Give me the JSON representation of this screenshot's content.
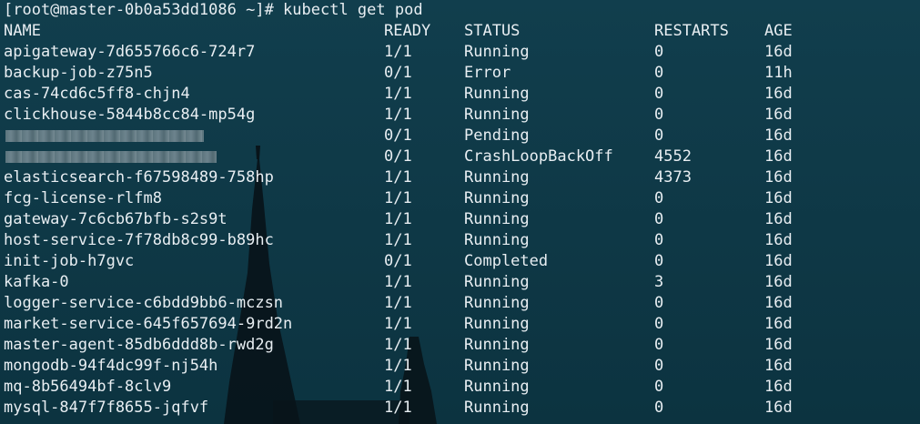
{
  "terminal": {
    "prompt": "[root@master-0b0a53dd1086 ~]# kubectl get pod",
    "headers": {
      "name": "NAME",
      "ready": "READY",
      "status": "STATUS",
      "restarts": "RESTARTS",
      "age": "AGE"
    },
    "rows": [
      {
        "name": "apigateway-7d655766c6-724r7",
        "ready": "1/1",
        "status": "Running",
        "restarts": "0",
        "age": "16d"
      },
      {
        "name": "backup-job-z75n5",
        "ready": "0/1",
        "status": "Error",
        "restarts": "0",
        "age": "11h"
      },
      {
        "name": "cas-74cd6c5ff8-chjn4",
        "ready": "1/1",
        "status": "Running",
        "restarts": "0",
        "age": "16d"
      },
      {
        "name": "clickhouse-5844b8cc84-mp54g",
        "ready": "1/1",
        "status": "Running",
        "restarts": "0",
        "age": "16d"
      },
      {
        "name": "",
        "ready": "0/1",
        "status": "Pending",
        "restarts": "0",
        "age": "16d",
        "redacted": true
      },
      {
        "name": "",
        "ready": "0/1",
        "status": "CrashLoopBackOff",
        "restarts": "4552",
        "age": "16d",
        "redacted": true
      },
      {
        "name": "elasticsearch-f67598489-758hp",
        "ready": "1/1",
        "status": "Running",
        "restarts": "4373",
        "age": "16d"
      },
      {
        "name": "fcg-license-rlfm8",
        "ready": "1/1",
        "status": "Running",
        "restarts": "0",
        "age": "16d"
      },
      {
        "name": "gateway-7c6cb67bfb-s2s9t",
        "ready": "1/1",
        "status": "Running",
        "restarts": "0",
        "age": "16d"
      },
      {
        "name": "host-service-7f78db8c99-b89hc",
        "ready": "1/1",
        "status": "Running",
        "restarts": "0",
        "age": "16d"
      },
      {
        "name": "init-job-h7gvc",
        "ready": "0/1",
        "status": "Completed",
        "restarts": "0",
        "age": "16d"
      },
      {
        "name": "kafka-0",
        "ready": "1/1",
        "status": "Running",
        "restarts": "3",
        "age": "16d"
      },
      {
        "name": "logger-service-c6bdd9bb6-mczsn",
        "ready": "1/1",
        "status": "Running",
        "restarts": "0",
        "age": "16d"
      },
      {
        "name": "market-service-645f657694-9rd2n",
        "ready": "1/1",
        "status": "Running",
        "restarts": "0",
        "age": "16d"
      },
      {
        "name": "master-agent-85db6ddd8b-rwd2g",
        "ready": "1/1",
        "status": "Running",
        "restarts": "0",
        "age": "16d"
      },
      {
        "name": "mongodb-94f4dc99f-nj54h",
        "ready": "1/1",
        "status": "Running",
        "restarts": "0",
        "age": "16d"
      },
      {
        "name": "mq-8b56494bf-8clv9",
        "ready": "1/1",
        "status": "Running",
        "restarts": "0",
        "age": "16d"
      },
      {
        "name": "mysql-847f7f8655-jqfvf",
        "ready": "1/1",
        "status": "Running",
        "restarts": "0",
        "age": "16d"
      }
    ]
  },
  "colors": {
    "background": "#0f3a48",
    "text": "#e8eef2",
    "silhouette": "#08141a"
  }
}
